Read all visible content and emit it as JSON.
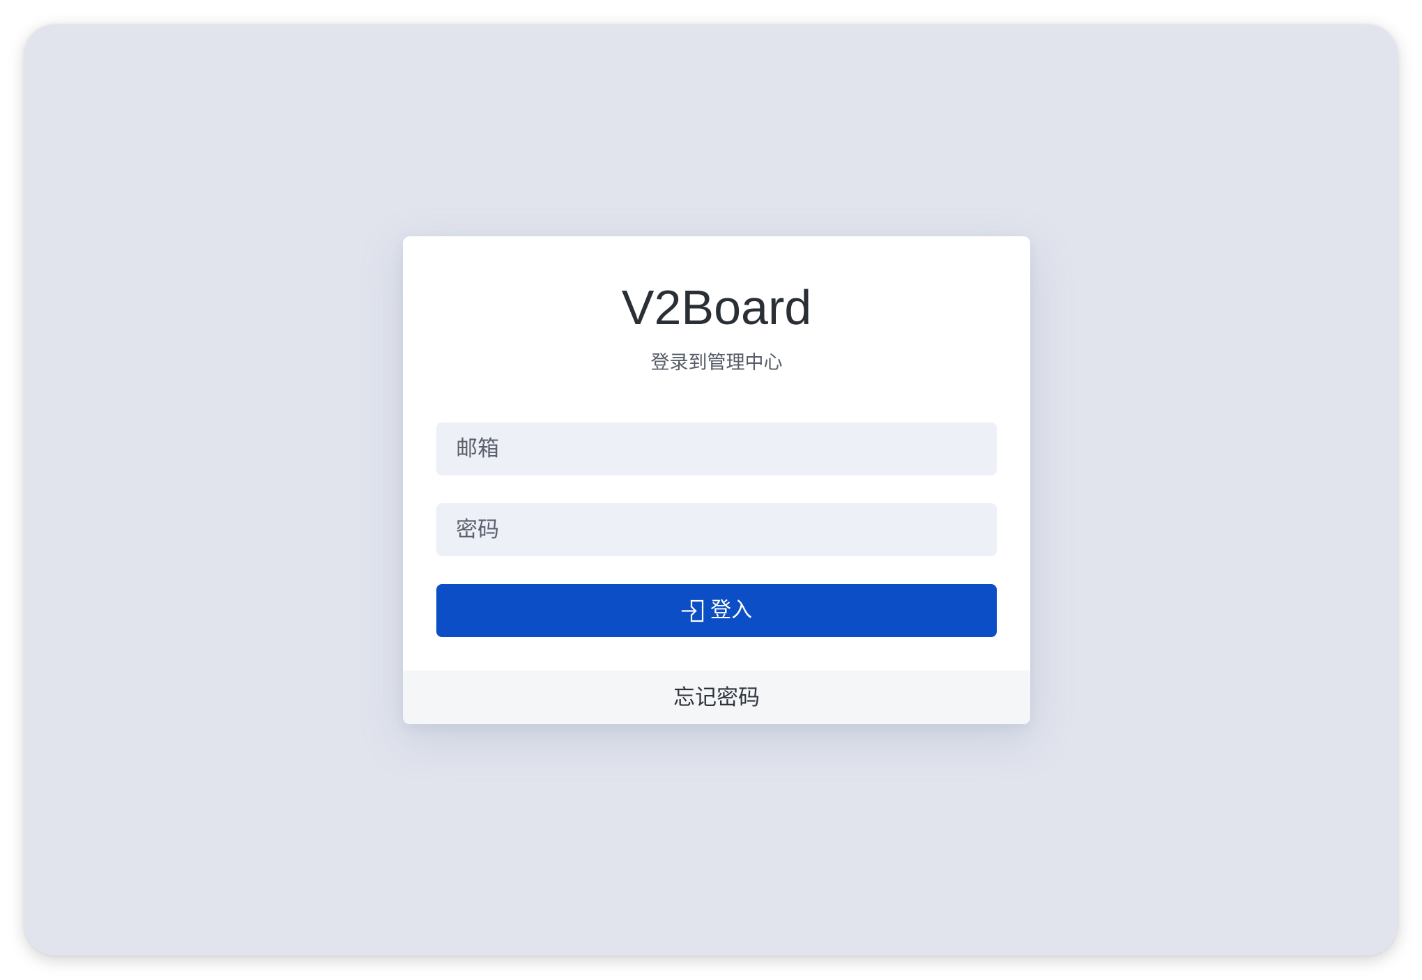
{
  "login": {
    "title": "V2Board",
    "subtitle": "登录到管理中心",
    "email_placeholder": "邮箱",
    "email_value": "",
    "password_placeholder": "密码",
    "password_value": "",
    "submit_label": "登入",
    "submit_icon": "login-icon",
    "forgot_label": "忘记密码"
  },
  "colors": {
    "background": "#e1e4ed",
    "card": "#ffffff",
    "input_bg": "#edf0f7",
    "primary": "#0b4ec5",
    "footer_bg": "#f5f6f8",
    "title_text": "#2a2e35"
  }
}
